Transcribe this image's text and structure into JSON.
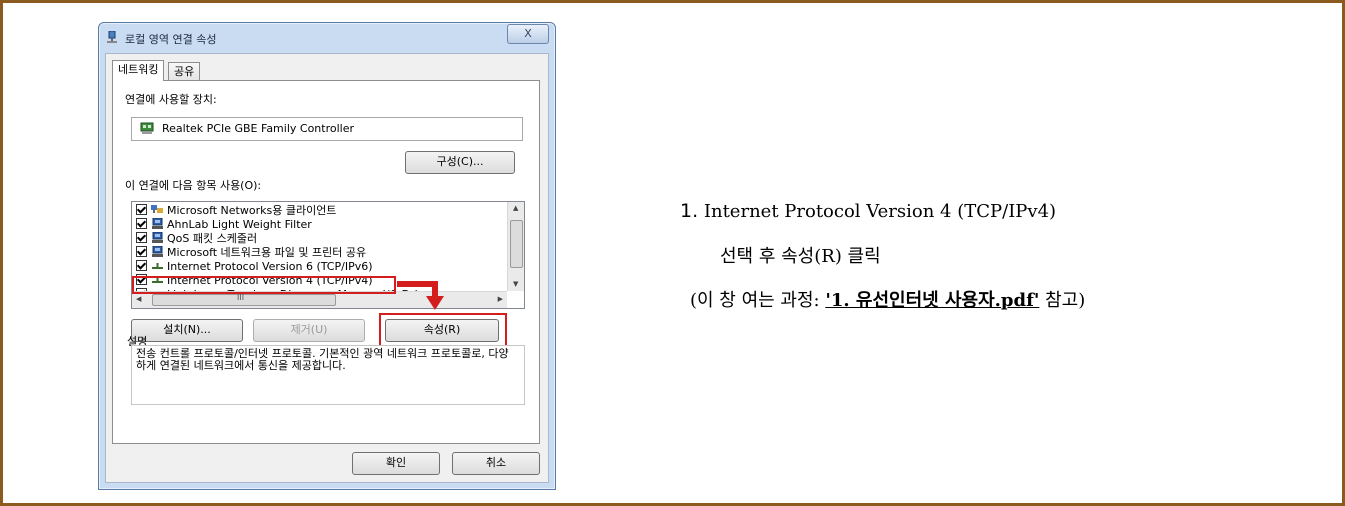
{
  "dialog": {
    "title": "로컬 영역 연결 속성",
    "close_label": "X",
    "tabs": [
      {
        "label": "네트워킹",
        "active": true
      },
      {
        "label": "공유",
        "active": false
      }
    ],
    "connect_using_label": "연결에 사용할 장치:",
    "device_name": "Realtek PCIe GBE Family Controller",
    "configure_button": "구성(C)...",
    "items_label": "이 연결에 다음 항목 사용(O):",
    "items": [
      {
        "label": "Microsoft Networks용 클라이언트",
        "checked": true,
        "icon": "network-client-icon"
      },
      {
        "label": "AhnLab Light Weight Filter",
        "checked": true,
        "icon": "service-icon"
      },
      {
        "label": "QoS 패킷 스케줄러",
        "checked": true,
        "icon": "service-icon"
      },
      {
        "label": "Microsoft 네트워크용 파일 및 프린터 공유",
        "checked": true,
        "icon": "service-icon"
      },
      {
        "label": "Internet Protocol Version 6 (TCP/IPv6)",
        "checked": true,
        "icon": "protocol-icon"
      },
      {
        "label": "Internet Protocol Version 4 (TCP/IPv4)",
        "checked": true,
        "icon": "protocol-icon"
      },
      {
        "label": "Link-Layer Topology Discovery Mapper I/O Driver",
        "checked": true,
        "icon": "protocol-icon"
      }
    ],
    "hscroll_grip": "III",
    "install_button": "설치(N)...",
    "uninstall_button": "제거(U)",
    "properties_button": "속성(R)",
    "description_label": "설명",
    "description_text": "전송 컨트롤 프로토콜/인터넷 프로토콜. 기본적인 광역 네트워크 프로토콜로, 다양하게 연결된 네트워크에서 통신을 제공합니다.",
    "ok_button": "확인",
    "cancel_button": "취소"
  },
  "instruction": {
    "step_number": "1.",
    "step_line1": "Internet Protocol Version 4 (TCP/IPv4)",
    "step_line2": "선택 후 속성(R) 클릭",
    "note_prefix": "(이 창 여는 과정: ",
    "note_link": "'1. 유선인터넷 사용자.pdf'",
    "note_suffix": " 참고)"
  },
  "colors": {
    "frame_border": "#8b5a1e",
    "highlight_red": "#d41e1e"
  }
}
